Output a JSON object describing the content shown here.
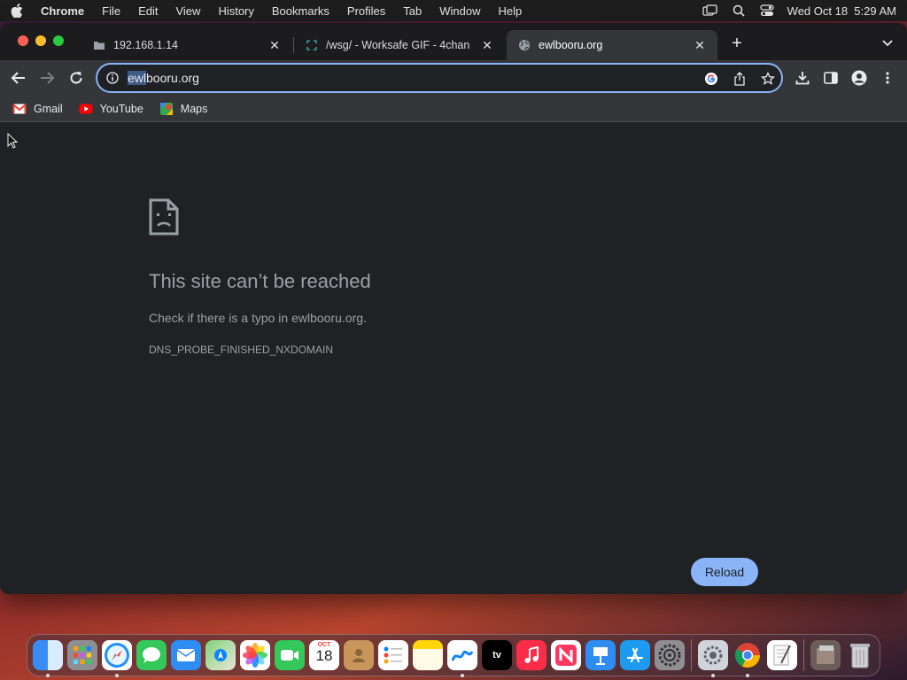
{
  "menubar": {
    "app_name": "Chrome",
    "items": [
      "File",
      "Edit",
      "View",
      "History",
      "Bookmarks",
      "Profiles",
      "Tab",
      "Window",
      "Help"
    ],
    "datetime": "Wed Oct 18  5:29 AM"
  },
  "tabs": [
    {
      "title": "192.168.1.14",
      "icon": "folder-icon",
      "active": false
    },
    {
      "title": "/wsg/ - Worksafe GIF - 4chan",
      "icon": "4chan-clover-icon",
      "active": false
    },
    {
      "title": "ewlbooru.org",
      "icon": "globe-icon",
      "active": true
    }
  ],
  "omnibox": {
    "url_selected": "ewl",
    "url_rest": "booru.org"
  },
  "bookmarks": [
    {
      "label": "Gmail",
      "icon": "gmail-icon"
    },
    {
      "label": "YouTube",
      "icon": "youtube-icon"
    },
    {
      "label": "Maps",
      "icon": "maps-icon"
    }
  ],
  "error": {
    "title": "This site can’t be reached",
    "message": "Check if there is a typo in ewlbooru.org.",
    "code": "DNS_PROBE_FINISHED_NXDOMAIN",
    "reload_label": "Reload"
  },
  "dock": {
    "calendar_month": "OCT",
    "calendar_day": "18",
    "tv_label": "tv",
    "apps": [
      "Finder",
      "Launchpad",
      "Safari",
      "Messages",
      "Mail",
      "Maps",
      "Photos",
      "FaceTime",
      "Calendar",
      "Contacts",
      "Reminders",
      "Notes",
      "Freeform",
      "TV",
      "Music",
      "News",
      "Keynote",
      "App Store",
      "System Settings",
      "Utility",
      "Chrome",
      "TextEdit",
      "Preview",
      "Trash"
    ]
  },
  "colors": {
    "accent": "#8ab4f8",
    "window_bg": "#202124",
    "toolbar_bg": "#35363a"
  }
}
